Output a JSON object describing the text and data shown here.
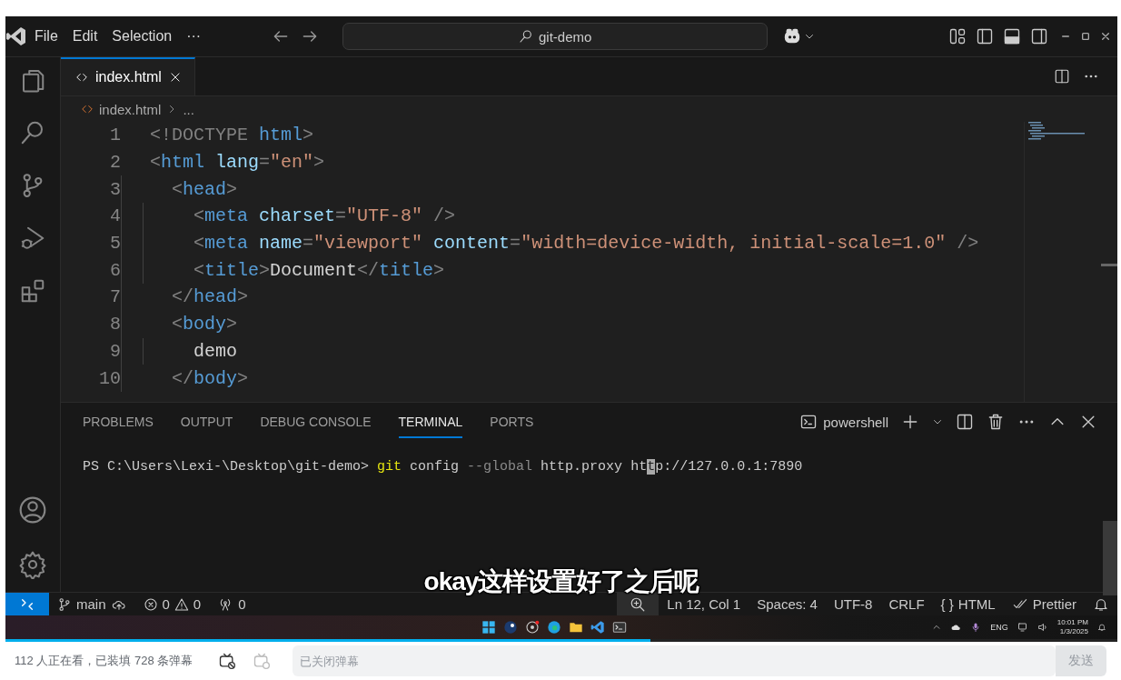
{
  "window": {
    "menu": [
      "File",
      "Edit",
      "Selection",
      "···"
    ],
    "search": "git-demo"
  },
  "tabs": [
    {
      "label": "index.html",
      "selected": true
    }
  ],
  "breadcrumb": [
    "index.html",
    "..."
  ],
  "code": [
    {
      "n": "1",
      "tokens": [
        {
          "kind": "p",
          "text": "<!DOCTYPE "
        },
        {
          "kind": "tag",
          "text": "html"
        },
        {
          "kind": "p",
          "text": ">"
        }
      ]
    },
    {
      "n": "2",
      "tokens": [
        {
          "kind": "p",
          "text": "<"
        },
        {
          "kind": "tag",
          "text": "html"
        },
        {
          "kind": "attr",
          "text": " lang"
        },
        {
          "kind": "p",
          "text": "="
        },
        {
          "kind": "str",
          "text": "\"en\""
        },
        {
          "kind": "p",
          "text": ">"
        }
      ]
    },
    {
      "n": "3",
      "tokens": [
        {
          "kind": "p",
          "text": "  <"
        },
        {
          "kind": "tag",
          "text": "head"
        },
        {
          "kind": "p",
          "text": ">"
        }
      ]
    },
    {
      "n": "4",
      "tokens": [
        {
          "kind": "p",
          "text": "    <"
        },
        {
          "kind": "tag",
          "text": "meta"
        },
        {
          "kind": "attr",
          "text": " charset"
        },
        {
          "kind": "p",
          "text": "="
        },
        {
          "kind": "str",
          "text": "\"UTF-8\""
        },
        {
          "kind": "p",
          "text": " />"
        }
      ]
    },
    {
      "n": "5",
      "tokens": [
        {
          "kind": "p",
          "text": "    <"
        },
        {
          "kind": "tag",
          "text": "meta"
        },
        {
          "kind": "attr",
          "text": " name"
        },
        {
          "kind": "p",
          "text": "="
        },
        {
          "kind": "str",
          "text": "\"viewport\""
        },
        {
          "kind": "attr",
          "text": " content"
        },
        {
          "kind": "p",
          "text": "="
        },
        {
          "kind": "str",
          "text": "\"width=device-width, initial-scale=1.0\""
        },
        {
          "kind": "p",
          "text": " />"
        }
      ]
    },
    {
      "n": "6",
      "tokens": [
        {
          "kind": "p",
          "text": "    <"
        },
        {
          "kind": "tag",
          "text": "title"
        },
        {
          "kind": "p",
          "text": ">"
        },
        {
          "kind": "text",
          "text": "Document"
        },
        {
          "kind": "p",
          "text": "</"
        },
        {
          "kind": "tag",
          "text": "title"
        },
        {
          "kind": "p",
          "text": ">"
        }
      ]
    },
    {
      "n": "7",
      "tokens": [
        {
          "kind": "p",
          "text": "  </"
        },
        {
          "kind": "tag",
          "text": "head"
        },
        {
          "kind": "p",
          "text": ">"
        }
      ]
    },
    {
      "n": "8",
      "tokens": [
        {
          "kind": "p",
          "text": "  <"
        },
        {
          "kind": "tag",
          "text": "body"
        },
        {
          "kind": "p",
          "text": ">"
        }
      ]
    },
    {
      "n": "9",
      "tokens": [
        {
          "kind": "text",
          "text": "    demo"
        }
      ]
    },
    {
      "n": "10",
      "tokens": [
        {
          "kind": "p",
          "text": "  </"
        },
        {
          "kind": "tag",
          "text": "body"
        },
        {
          "kind": "p",
          "text": ">"
        }
      ]
    }
  ],
  "panel": {
    "tabs": [
      {
        "label": "PROBLEMS",
        "selected": false
      },
      {
        "label": "OUTPUT",
        "selected": false
      },
      {
        "label": "DEBUG CONSOLE",
        "selected": false
      },
      {
        "label": "TERMINAL",
        "selected": true
      },
      {
        "label": "PORTS",
        "selected": false
      }
    ],
    "shell": "powershell",
    "terminal": [
      {
        "kind": "text",
        "text": "PS C:\\Users\\Lexi-\\Desktop\\git-demo> "
      },
      {
        "kind": "cmd",
        "text": "git"
      },
      {
        "kind": "text",
        "text": " config "
      },
      {
        "kind": "flag",
        "text": "--global"
      },
      {
        "kind": "text",
        "text": " http.proxy ht"
      },
      {
        "kind": "cursor",
        "text": "t"
      },
      {
        "kind": "text",
        "text": "p://127.0.0.1:7890"
      }
    ]
  },
  "subtitle": "okay这样设置好了之后呢",
  "status_bar": {
    "branch": "main",
    "errors": "0",
    "warnings": "0",
    "ports": "0",
    "right": [
      "Ln 12, Col 1",
      "Spaces: 4",
      "UTF-8",
      "CRLF"
    ],
    "braces": "{ }",
    "language": "HTML",
    "formatter": "Prettier"
  },
  "tray": {
    "lang": "ENG",
    "time": "10:01 PM",
    "date": "1/3/2025"
  },
  "progress": {
    "level": 0.58
  },
  "danmaku": {
    "viewers": "112 人正在看，已装填 728 条弹幕",
    "placeholder": "已关闭弹幕",
    "send": "发送"
  }
}
